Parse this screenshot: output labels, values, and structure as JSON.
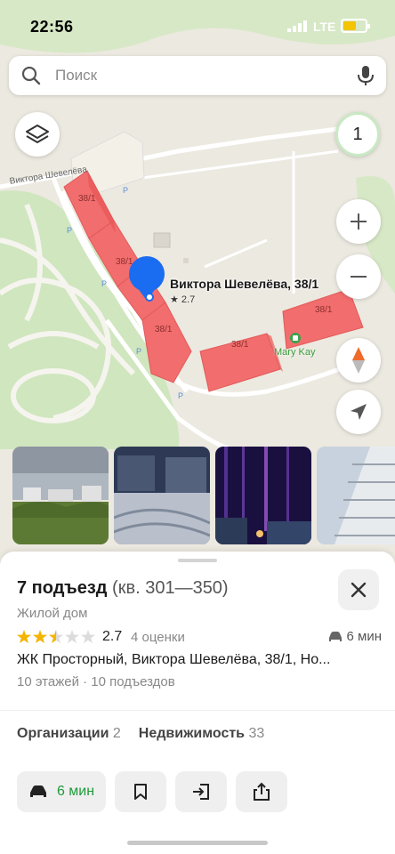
{
  "status_bar": {
    "time": "22:56",
    "network": "LTE"
  },
  "search": {
    "placeholder": "Поиск"
  },
  "map": {
    "counter": "1",
    "street": "Виктора Шевелёва",
    "building_numbers": [
      "38/1",
      "38/1",
      "38/1",
      "38/1",
      "38/1"
    ],
    "pin_title": "Виктора Шевелёва, 38/1",
    "pin_rating": "★ 2.7",
    "poi_mary_kay": "Mary Kay",
    "colors": {
      "building": "#f26d6d",
      "park": "#cfe6bf",
      "pin": "#1a6cf0",
      "route_green": "#1e9a3a"
    }
  },
  "card": {
    "title": "7 подъезд",
    "apartments": "(кв. 301—350)",
    "subtitle": "Жилой дом",
    "rating": "2.7",
    "rating_stars": 2.5,
    "rating_count": "4 оценки",
    "drive_time": "6 мин",
    "address": "ЖК Просторный, Виктора Шевелёва, 38/1, Но...",
    "floors": "10 этажей · 10 подъездов",
    "tabs": [
      {
        "label": "Организации",
        "count": "2"
      },
      {
        "label": "Недвижимость",
        "count": "33"
      }
    ],
    "route_label": "6 мин"
  }
}
